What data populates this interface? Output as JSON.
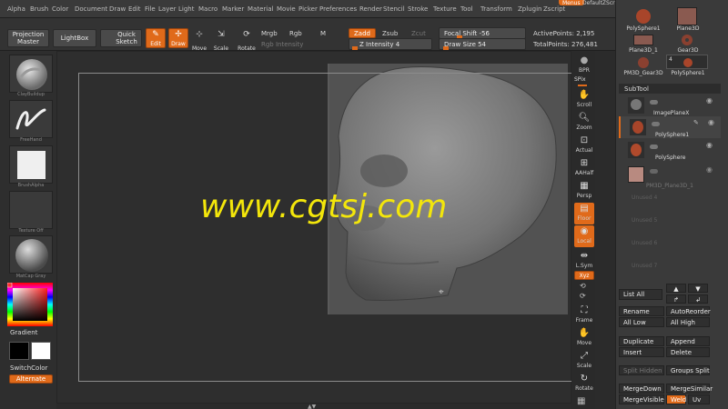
{
  "menubar": {
    "items": [
      "Alpha",
      "Brush",
      "Color",
      "Document",
      "Draw",
      "Edit",
      "File",
      "Layer",
      "Light",
      "Macro",
      "Marker",
      "Material",
      "Movie",
      "Picker",
      "Preferences",
      "Render",
      "Stencil",
      "Stroke",
      "Texture",
      "Tool",
      "Transform",
      "Zplugin",
      "Zscript"
    ],
    "right_pill": "Menus",
    "right_text": "DefaultZScript"
  },
  "toolbar": {
    "projection_master": "Projection Master",
    "lightbox": "LightBox",
    "quick_sketch": "Quick Sketch",
    "edit": "Edit",
    "draw": "Draw",
    "move": "Move",
    "scale": "Scale",
    "rotate": "Rotate",
    "mrgb": "Mrgb",
    "rgb": "Rgb",
    "m": "M",
    "rgb_intensity": "Rgb Intensity",
    "zadd": "Zadd",
    "zsub": "Zsub",
    "zcut": "Zcut",
    "z_intensity": "Z Intensity 4",
    "focal_shift": "Focal Shift -56",
    "draw_size": "Draw Size 54",
    "active_points": "ActivePoints: 2,195",
    "total_points": "TotalPoints: 276,481",
    "z_intensity_level": 0.04,
    "focal_shift_level": 0.22,
    "draw_size_level": 0.05
  },
  "leftshelf": {
    "brush_caption": "ClayBuildup",
    "stroke_caption": "FreeHand",
    "alpha_caption": "BrushAlpha",
    "texture_caption": "Texture Off",
    "material_caption": "MatCap Gray",
    "gradient": "Gradient",
    "switchcolor": "SwitchColor",
    "alternate": "Alternate"
  },
  "viewport": {
    "watermark": "www.cgtsj.com"
  },
  "rightshelf": {
    "bpr": "BPR",
    "spix": "SPix",
    "scroll": "Scroll",
    "zoom": "Zoom",
    "actual": "Actual",
    "aahalf": "AAHalf",
    "persp": "Persp",
    "floor": "Floor",
    "local": "Local",
    "lsym": "L.Sym",
    "xyz": "Xyz",
    "frame": "Frame",
    "move": "Move",
    "scale": "Scale",
    "rotate": "Rotate"
  },
  "rightpanel": {
    "tools": [
      "PolySphere1",
      "Plane3D",
      "Plane3D_1",
      "Gear3D",
      "PM3D_Gear3D",
      "PolySphere1"
    ],
    "tool_badge": "4",
    "subtool_title": "SubTool",
    "subtools": [
      "ImagePlaneX",
      "PolySphere1",
      "PolySphere",
      "PM3D_Plane3D_1"
    ],
    "unused": [
      "Unused 4",
      "Unused 5",
      "Unused 6",
      "Unused 7"
    ],
    "list_all": "List All",
    "rename": "Rename",
    "autoreorder": "AutoReorder",
    "all_low": "All Low",
    "all_high": "All High",
    "duplicate": "Duplicate",
    "append": "Append",
    "insert": "Insert",
    "delete": "Delete",
    "split_hidden": "Split Hidden",
    "groups_split": "Groups Split",
    "mergedown": "MergeDown",
    "mergesimilar": "MergeSimilar",
    "mergevisible": "MergeVisible",
    "weld": "Weld",
    "uv": "Uv"
  },
  "colors": {
    "accent": "#e06a1a",
    "watermark": "#f3e60b"
  }
}
